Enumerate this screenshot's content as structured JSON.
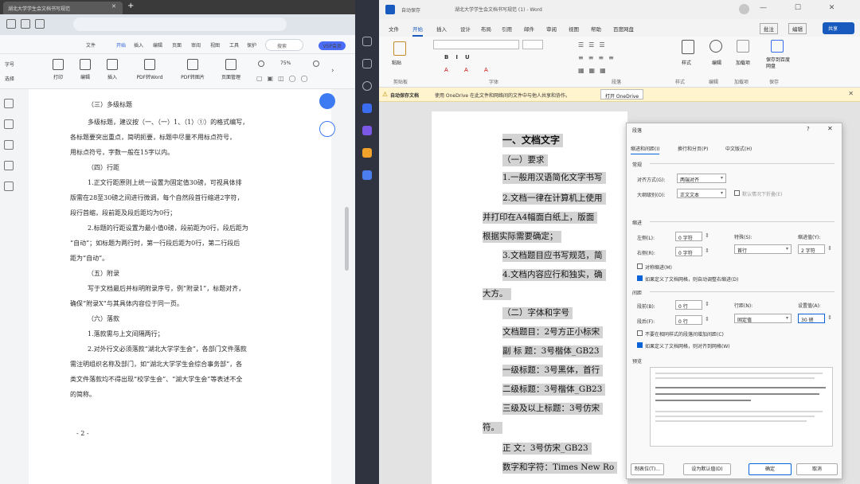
{
  "left_window": {
    "tab_title": "湖北大学学生会文档书写规范",
    "menu": [
      "文件",
      "开始",
      "插入",
      "编辑",
      "页面",
      "审阅",
      "视图",
      "工具",
      "会员",
      "保护"
    ],
    "active_menu": "开始",
    "search_label": "搜索",
    "vip_label": "VSP会员",
    "ribbon": {
      "b1": "字号",
      "b2": "选择",
      "b3": "打印",
      "b4": "编辑",
      "b5": "插入",
      "b6": "PDF转Word",
      "b7": "PDF转图片",
      "b8": "页面管理",
      "zoom": "75%"
    },
    "page": {
      "lines": [
        "（三）多级标题",
        "多级标题，建议按（一、（一）1、（1）①）的格式编写，",
        "各标题要突出重点，简明扼要，标题中尽量不用标点符号，",
        "用标点符号，字数一般在15字以内。",
        "（四）行距",
        "1.正文行距原则上统一设置为固定值30磅，可视具体排",
        "版需在28至30磅之间进行微调，每个自然段首行缩进2字符，",
        "段行首缩，段前距及段后距均为0行；",
        "2.标题的行距设置为最小值0磅，段前距为0行，段后距为",
        "“自动”；如标题为两行时，第一行段后距为0行，第二行段后",
        "距为“自动”。",
        "（五）附录",
        "写于文档最后并标明附录序号，例“附录1”，标题对齐，",
        "确保“附录X”与其具体内容位于同一页。",
        "（六）落款",
        "1.落款需与上文间隔两行；",
        "2.对外行文必须落款“湖北大学学生会”，各部门文件落款",
        "需注明组织名称及部门，如“湖北大学学生会综合事务部”，各",
        "类文件落款均不得出现“校学生会”、“湖大学生会”等表述不全",
        "的简称。"
      ],
      "page_number": "- 2 -"
    }
  },
  "word_window": {
    "autosave": "自动保存",
    "title": "湖北大学学生会文档书写规范 (1) - Word",
    "tabs": [
      "文件",
      "开始",
      "插入",
      "设计",
      "布局",
      "引用",
      "邮件",
      "审阅",
      "视图",
      "帮助",
      "百度网盘"
    ],
    "active_tab": "开始",
    "comment_label": "批注",
    "edit_label": "编辑",
    "share_label": "共享",
    "ribbon_groups": [
      "剪贴板",
      "字体",
      "段落",
      "样式",
      "编辑",
      "加载项",
      "保存"
    ],
    "ribbon_buttons": {
      "paste": "粘贴",
      "styles": "样式",
      "edit": "编辑",
      "addins": "加载项",
      "save": "保存到百度网盘"
    },
    "message": {
      "title": "自动保存文档",
      "text": "使用 OneDrive 在此文件和网络间的文件中与他人共享和协作。",
      "button": "打开 OneDrive"
    },
    "doc_lines": [
      "一、文档文字",
      "（一）要求",
      "1.一般用汉语简化文字书写",
      "2.文档一律在计算机上使用",
      "并打印在A4幅面白纸上，版面",
      "根据实际需要确定；",
      "3.文档题目应书写规范，简",
      "4.文档内容应行和独实，确",
      "大方。",
      "（二）字体和字号",
      "文档题目：2号方正小标宋",
      "副 标 题：3号楷体_GB23",
      "一级标题：3号黑体，首行",
      "二级标题：3号楷体_GB23",
      "三级及以上标题：3号仿宋",
      "符。",
      "正    文：3号仿宋_GB23",
      "数字和字符：Times New Ro"
    ]
  },
  "dialog": {
    "title": "段落",
    "tabs": [
      "缩进和间距(I)",
      "换行和分页(P)",
      "中文版式(H)"
    ],
    "general": "常规",
    "alignment_label": "对齐方式(G):",
    "alignment_value": "两端对齐",
    "outline_label": "大纲级别(O):",
    "outline_value": "正文文本",
    "collapsed_label": "默认情况下折叠(E)",
    "indent": "缩进",
    "left_label": "左侧(L):",
    "left_value": "0 字符",
    "right_label": "右侧(R):",
    "right_value": "0 字符",
    "special_label": "特殊(S):",
    "special_value": "首行",
    "indent_value_label": "缩进值(Y):",
    "indent_value": "2 字符",
    "mirror_label": "对称缩进(M)",
    "auto_adjust_label": "如果定义了文档网格，则自动调整右缩进(D)",
    "spacing": "间距",
    "before_label": "段前(B):",
    "before_value": "0 行",
    "after_label": "段后(F):",
    "after_value": "0 行",
    "line_spacing_label": "行距(N):",
    "line_spacing_value": "固定值",
    "at_label": "设置值(A):",
    "at_value": "30 磅",
    "no_space_label": "不要在相同样式的段落间增加间距(C)",
    "snap_grid_label": "如果定义了文档网格，则对齐到网格(W)",
    "preview": "预览",
    "tabs_button": "制表位(T)...",
    "default_button": "设为默认值(D)",
    "ok": "确定",
    "cancel": "取消"
  }
}
